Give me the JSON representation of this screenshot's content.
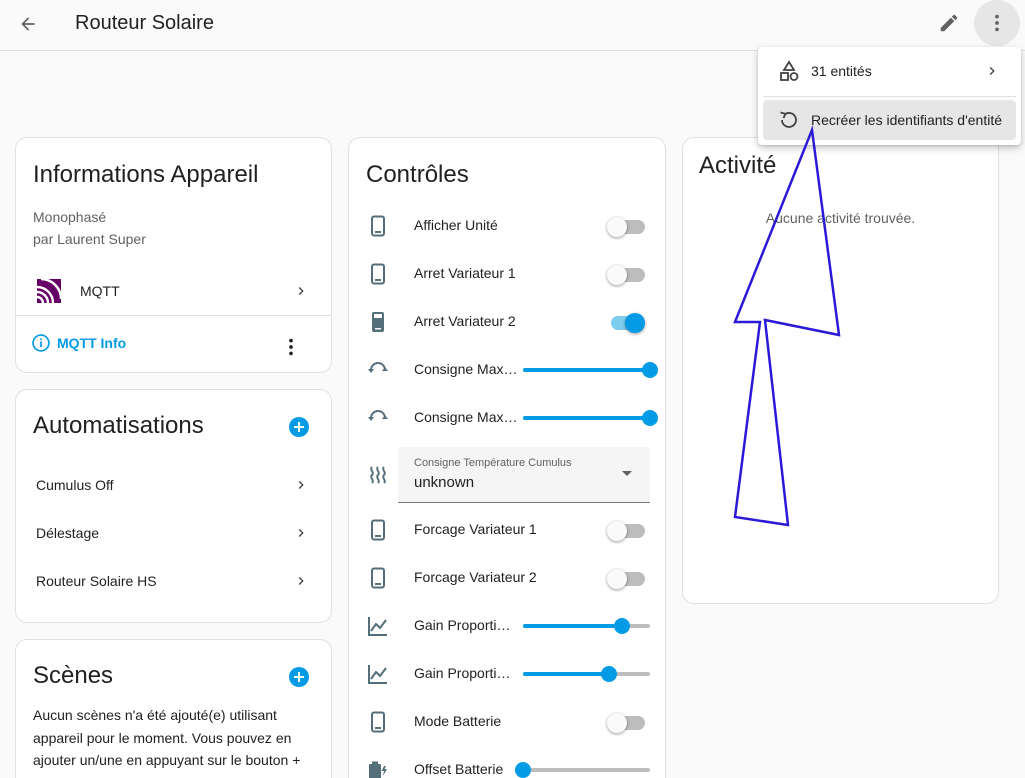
{
  "header": {
    "title": "Routeur Solaire"
  },
  "device_info": {
    "title": "Informations Appareil",
    "model": "Monophasé",
    "manufacturer": "par Laurent Super",
    "integration": "MQTT",
    "action_link": "MQTT Info"
  },
  "automations": {
    "title": "Automatisations",
    "items": [
      {
        "label": "Cumulus Off"
      },
      {
        "label": "Délestage"
      },
      {
        "label": "Routeur Solaire HS"
      }
    ]
  },
  "scenes": {
    "title": "Scènes",
    "empty_text": "Aucun scènes n'a été ajouté(e) utilisant appareil pour le moment. Vous pouvez en ajouter un/une en appuyant sur le bouton + ci-des"
  },
  "controls": {
    "title": "Contrôles",
    "items": [
      {
        "label": "Afficher Unité",
        "kind": "toggle",
        "on": false,
        "icon": "cellphone-icon"
      },
      {
        "label": "Arret Variateur 1",
        "kind": "toggle",
        "on": false,
        "icon": "cellphone-icon"
      },
      {
        "label": "Arret Variateur 2",
        "kind": "toggle",
        "on": true,
        "icon": "cellphone-filled-icon"
      },
      {
        "label": "Consigne Max…",
        "kind": "slider",
        "value": 1.0,
        "icon": "rotate-arrows-icon"
      },
      {
        "label": "Consigne Max…",
        "kind": "slider",
        "value": 1.0,
        "icon": "rotate-arrows-icon"
      },
      {
        "label": "Forcage Variateur 1",
        "kind": "toggle",
        "on": false,
        "icon": "cellphone-icon"
      },
      {
        "label": "Forcage Variateur 2",
        "kind": "toggle",
        "on": false,
        "icon": "cellphone-icon"
      },
      {
        "label": "Gain Proporti…",
        "kind": "slider",
        "value": 0.78,
        "icon": "chart-line-icon"
      },
      {
        "label": "Gain Proporti…",
        "kind": "slider",
        "value": 0.68,
        "icon": "chart-line-icon"
      },
      {
        "label": "Mode Batterie",
        "kind": "toggle",
        "on": false,
        "icon": "cellphone-icon"
      },
      {
        "label": "Offset Batterie",
        "kind": "slider",
        "value": 0.0,
        "icon": "battery-charging-icon"
      }
    ],
    "select": {
      "label": "Consigne Température Cumulus",
      "value": "unknown",
      "icon": "heat-waves-icon"
    }
  },
  "activity": {
    "title": "Activité",
    "empty_text": "Aucune activité trouvée."
  },
  "menu": {
    "items": [
      {
        "label": "31 entités",
        "icon": "shapes-icon"
      },
      {
        "label": "Recréer les identifiants d'entité",
        "icon": "refresh-icon"
      }
    ]
  },
  "colors": {
    "accent": "#039be5",
    "annotation_arrow": "#2a1ad8",
    "mqtt_logo": "#660066"
  }
}
